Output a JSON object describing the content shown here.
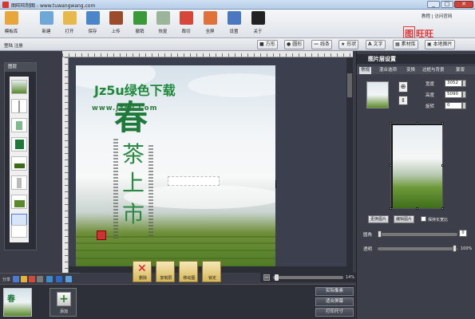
{
  "window": {
    "title": "图旺旺制图 - www.tuwangwang.com",
    "min": "_",
    "max": "□",
    "close": "✕"
  },
  "toolbar": {
    "buttons": [
      {
        "label": "模板库",
        "icon": "template-icon",
        "color": "#e7a63a"
      },
      {
        "label": "新建",
        "icon": "new-icon",
        "color": "#6ea8d8"
      },
      {
        "label": "打开",
        "icon": "open-folder-icon",
        "color": "#e7b84a"
      },
      {
        "label": "保存",
        "icon": "save-icon",
        "color": "#4a86c8"
      },
      {
        "label": "上传",
        "icon": "upload-icon",
        "color": "#9c4b2a"
      },
      {
        "label": "撤销",
        "icon": "undo-icon",
        "color": "#3a9a3a"
      },
      {
        "label": "恢复",
        "icon": "redo-icon",
        "color": "#9ab59a"
      },
      {
        "label": "裁切",
        "icon": "scissors-icon",
        "color": "#d8463a"
      },
      {
        "label": "全屏",
        "icon": "fullscreen-icon",
        "color": "#e2703a"
      },
      {
        "label": "设置",
        "icon": "gear-icon",
        "color": "#4a78c0"
      },
      {
        "label": "关于",
        "icon": "help-icon",
        "color": "#222"
      }
    ],
    "links": "教程 | 访问官网",
    "logo_box": "图",
    "logo_text": "旺旺"
  },
  "row2": {
    "account": "登陆 注册",
    "shapes": [
      {
        "label": "方形",
        "glyph": "■"
      },
      {
        "label": "圆形",
        "glyph": "●"
      },
      {
        "label": "线条",
        "glyph": "—"
      },
      {
        "label": "形状",
        "glyph": "★"
      },
      {
        "label": "文字",
        "glyph": "A"
      },
      {
        "label": "素材库",
        "glyph": "▦"
      },
      {
        "label": "本地图片",
        "glyph": "▣"
      }
    ]
  },
  "layers": {
    "title": "图层"
  },
  "canvas": {
    "big_char": "春",
    "chars": [
      "茶",
      "上",
      "市"
    ],
    "watermark1": "Jz5u绿色下载",
    "watermark2": "www.Jz5u.Com"
  },
  "bottom_tools": [
    {
      "label": "删除"
    },
    {
      "label": "复制层"
    },
    {
      "label": "移动图"
    },
    {
      "label": "锁定"
    }
  ],
  "zoom": {
    "value": "14%",
    "minus": "−",
    "plus": "+"
  },
  "icon_strip": {
    "label": "分享"
  },
  "bottom_panel": {
    "add_label": "添加",
    "add_glyph": "+",
    "buttons": [
      "实际像素",
      "适合屏幕",
      "打印尺寸"
    ]
  },
  "rpanel": {
    "title": "图片层设置",
    "tabs": [
      "常规",
      "混合选项",
      "变换",
      "边框与背景",
      "蒙版"
    ],
    "width_label": "宽度",
    "width_value": "3052",
    "height_label": "高度",
    "height_value": "5090",
    "rotate_label": "旋转",
    "rotate_value": "0",
    "lock_glyph": "⊕",
    "arrow_glyph": "⇕",
    "btn_change": "更换图片",
    "btn_edit": "编辑图片",
    "keep_ratio": "保持长宽比",
    "radius_label": "圆角",
    "radius_value": "0",
    "opacity_label": "透明",
    "opacity_value": "100%"
  }
}
